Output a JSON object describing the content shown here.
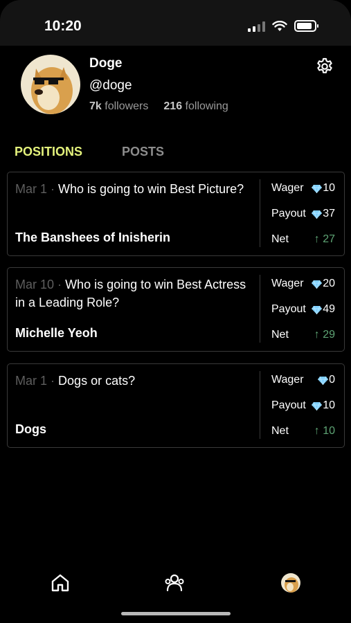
{
  "status_bar": {
    "time": "10:20"
  },
  "profile": {
    "name": "Doge",
    "handle": "@doge",
    "followers_count": "7k",
    "followers_label": "followers",
    "following_count": "216",
    "following_label": "following"
  },
  "tabs": [
    {
      "label": "POSITIONS",
      "active": true
    },
    {
      "label": "POSTS",
      "active": false
    }
  ],
  "positions": [
    {
      "date": "Mar 1",
      "separator": "·",
      "question": "Who is going to win Best Picture?",
      "answer": "The Banshees of Inisherin",
      "wager_label": "Wager",
      "wager": "10",
      "payout_label": "Payout",
      "payout": "37",
      "net_label": "Net",
      "net": "↑ 27"
    },
    {
      "date": "Mar 10",
      "separator": "·",
      "question": "Who is going to win Best Actress in a Leading Role?",
      "answer": "Michelle Yeoh",
      "wager_label": "Wager",
      "wager": "20",
      "payout_label": "Payout",
      "payout": "49",
      "net_label": "Net",
      "net": "↑ 29"
    },
    {
      "date": "Mar 1",
      "separator": "·",
      "question": "Dogs or cats?",
      "answer": "Dogs",
      "wager_label": "Wager",
      "wager": "0",
      "payout_label": "Payout",
      "payout": "10",
      "net_label": "Net",
      "net": "↑ 10"
    }
  ],
  "bottom_nav": [
    {
      "icon": "home-icon"
    },
    {
      "icon": "people-icon"
    },
    {
      "icon": "profile-avatar-icon"
    }
  ],
  "colors": {
    "accent_tab": "#e4f27c",
    "net_positive": "#5ea474",
    "gem": "#7fd0ff"
  }
}
